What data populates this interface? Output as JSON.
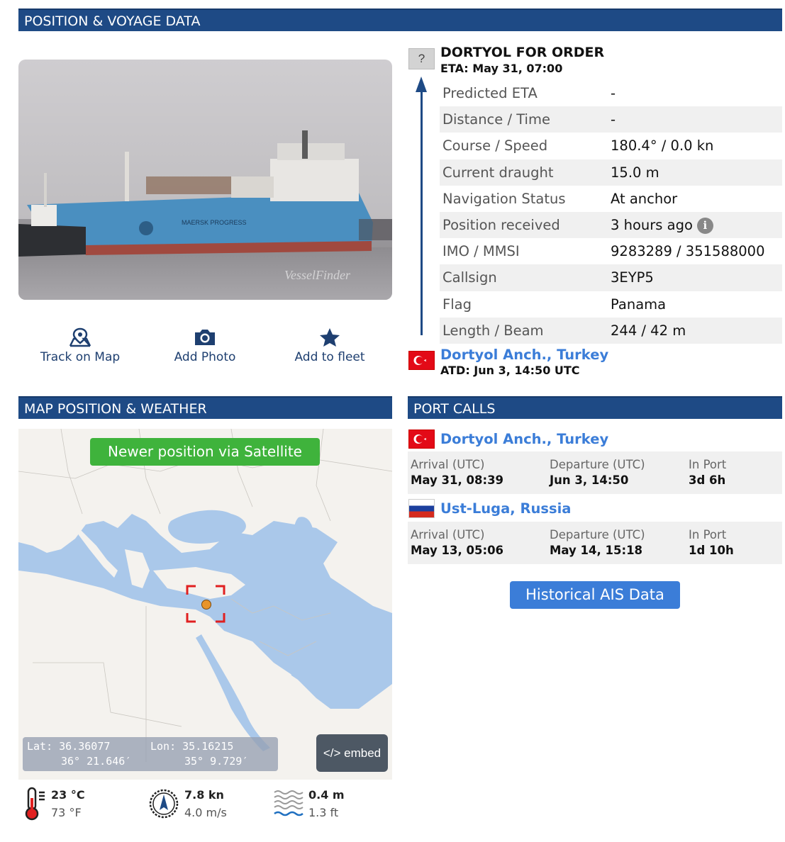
{
  "sections": {
    "position_voyage": "POSITION & VOYAGE DATA",
    "map_weather": "MAP POSITION & WEATHER",
    "port_calls": "PORT CALLS"
  },
  "photo": {
    "watermark": "VesselFinder"
  },
  "actions": {
    "track": "Track on Map",
    "add_photo": "Add Photo",
    "add_fleet": "Add to fleet"
  },
  "voyage": {
    "destination_flag": "?",
    "destination": "DORTYOL FOR ORDER",
    "eta": "ETA: May 31, 07:00",
    "rows": [
      {
        "label": "Predicted ETA",
        "value": "-"
      },
      {
        "label": "Distance / Time",
        "value": "-"
      },
      {
        "label": "Course / Speed",
        "value": "180.4° / 0.0 kn"
      },
      {
        "label": "Current draught",
        "value": "15.0 m"
      },
      {
        "label": "Navigation Status",
        "value": "At anchor"
      },
      {
        "label": "Position received",
        "value": "3 hours ago"
      },
      {
        "label": "IMO / MMSI",
        "value": "9283289 / 351588000"
      },
      {
        "label": "Callsign",
        "value": "3EYP5"
      },
      {
        "label": "Flag",
        "value": "Panama"
      },
      {
        "label": "Length / Beam",
        "value": "244 / 42 m"
      }
    ],
    "last_port": "Dortyol Anch., Turkey",
    "atd": "ATD: Jun 3, 14:50 UTC"
  },
  "map": {
    "satellite_button": "Newer position via Satellite",
    "lat_label": "Lat: 36.36077",
    "lat_dms": "36° 21.646′",
    "lon_label": "Lon: 35.16215",
    "lon_dms": "35° 9.729′",
    "embed": "</> embed"
  },
  "weather": {
    "temp_c": "23 °C",
    "temp_f": "73 °F",
    "wind_kn": "7.8 kn",
    "wind_ms": "4.0 m/s",
    "wave_m": "0.4 m",
    "wave_ft": "1.3 ft"
  },
  "port_calls": [
    {
      "port": "Dortyol Anch., Turkey",
      "arrival_label": "Arrival (UTC)",
      "arrival": "May 31, 08:39",
      "departure_label": "Departure (UTC)",
      "departure": "Jun 3, 14:50",
      "inport_label": "In Port",
      "inport": "3d 6h"
    },
    {
      "port": "Ust-Luga, Russia",
      "arrival_label": "Arrival (UTC)",
      "arrival": "May 13, 05:06",
      "departure_label": "Departure (UTC)",
      "departure": "May 14, 15:18",
      "inport_label": "In Port",
      "inport": "1d 10h"
    }
  ],
  "historical_button": "Historical AIS Data",
  "colors": {
    "header": "#1e4a85",
    "link": "#3b7dd8",
    "satellite": "#3fb33c",
    "marker": "#e67e22",
    "target_box": "#e02020"
  }
}
